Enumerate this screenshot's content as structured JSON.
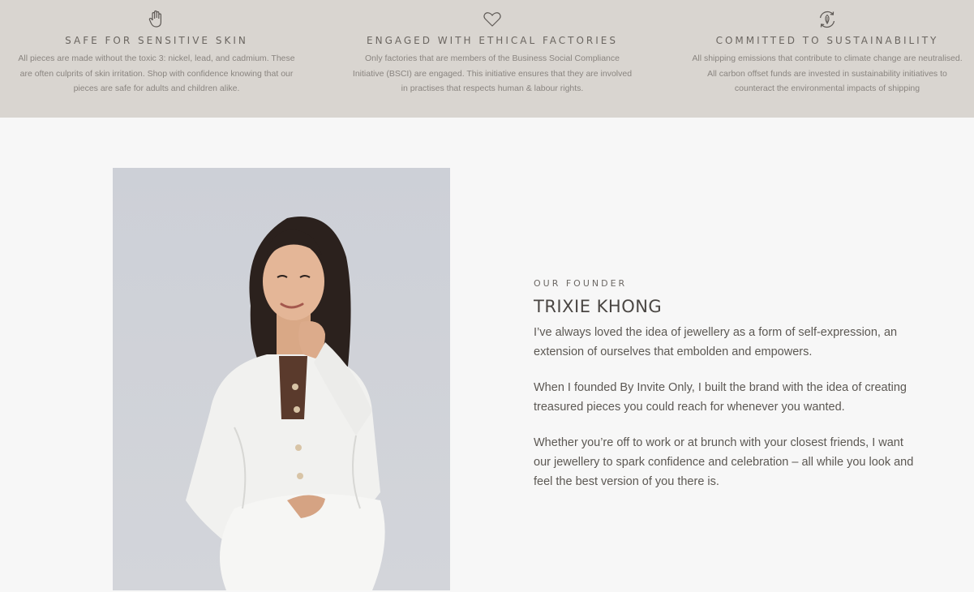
{
  "values": [
    {
      "icon": "hand-icon",
      "title": "SAFE FOR SENSITIVE SKIN",
      "description": "All pieces are made without the toxic 3: nickel, lead, and cadmium. These are often culprits of skin irritation. Shop with confidence knowing that our pieces are safe for adults and children alike."
    },
    {
      "icon": "heart-icon",
      "title": "ENGAGED WITH ETHICAL FACTORIES",
      "description": "Only factories that are members of the Business Social Compliance Initiative (BSCI) are engaged. This initiative ensures that they are involved in practises that respects human & labour rights."
    },
    {
      "icon": "recycle-leaf-icon",
      "title": "COMMITTED TO SUSTAINABILITY",
      "description": "All shipping emissions that contribute to climate change are neutralised. All carbon offset funds are invested in sustainability initiatives to counteract the environmental impacts of shipping"
    }
  ],
  "founder": {
    "kicker": "OUR FOUNDER",
    "name": "TRIXIE KHONG",
    "paragraphs": [
      "I’ve always loved the idea of jewellery as a form of self-expression, an extension of ourselves that embolden and empowers.",
      "When I founded By Invite Only, I built the brand with the idea of creating treasured pieces you could reach for whenever you wanted.",
      "Whether you’re off to work or at brunch with your closest friends, I want our jewellery to spark confidence and celebration – all while you look and feel the best version of you there is."
    ]
  },
  "colors": {
    "band": "#d9d5d0",
    "background": "#f7f7f7",
    "text": "#5c5853"
  }
}
